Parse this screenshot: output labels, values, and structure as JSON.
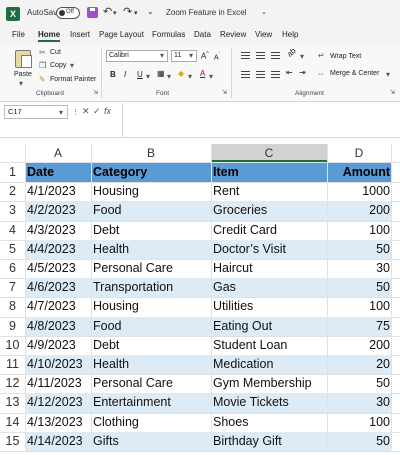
{
  "titlebar": {
    "app_logo": "X",
    "autosave_label": "AutoSave",
    "toggle_state": "Off",
    "document_title": "Zoom Feature in Excel"
  },
  "menu": {
    "tabs": [
      "File",
      "Home",
      "Insert",
      "Page Layout",
      "Formulas",
      "Data",
      "Review",
      "View",
      "Help"
    ],
    "active": "Home"
  },
  "ribbon": {
    "clipboard": {
      "paste": "Paste",
      "cut": "Cut",
      "copy": "Copy",
      "format_painter": "Format Painter",
      "group_label": "Clipboard"
    },
    "font": {
      "font_name": "Calibri",
      "font_size": "11",
      "bold": "B",
      "italic": "I",
      "underline": "U",
      "font_color_glyph": "A",
      "group_label": "Font"
    },
    "alignment": {
      "wrap_text": "Wrap Text",
      "merge_center": "Merge & Center",
      "group_label": "Alignment"
    }
  },
  "formula_bar": {
    "name_box": "C17",
    "fx": "fx",
    "value": ""
  },
  "sheet": {
    "columns": [
      "A",
      "B",
      "C",
      "D"
    ],
    "selected_column": "C",
    "row_numbers": [
      "1",
      "2",
      "3",
      "4",
      "5",
      "6",
      "7",
      "8",
      "9",
      "10",
      "11",
      "12",
      "13",
      "14",
      "15"
    ],
    "header": {
      "date": "Date",
      "category": "Category",
      "item": "Item",
      "amount": "Amount"
    },
    "rows": [
      {
        "date": "4/1/2023",
        "category": "Housing",
        "item": "Rent",
        "amount": "1000"
      },
      {
        "date": "4/2/2023",
        "category": "Food",
        "item": "Groceries",
        "amount": "200"
      },
      {
        "date": "4/3/2023",
        "category": "Debt",
        "item": "Credit Card",
        "amount": "100"
      },
      {
        "date": "4/4/2023",
        "category": "Health",
        "item": "Doctor’s Visit",
        "amount": "50"
      },
      {
        "date": "4/5/2023",
        "category": "Personal Care",
        "item": "Haircut",
        "amount": "30"
      },
      {
        "date": "4/6/2023",
        "category": "Transportation",
        "item": "Gas",
        "amount": "50"
      },
      {
        "date": "4/7/2023",
        "category": "Housing",
        "item": "Utilities",
        "amount": "100"
      },
      {
        "date": "4/8/2023",
        "category": "Food",
        "item": "Eating Out",
        "amount": "75"
      },
      {
        "date": "4/9/2023",
        "category": "Debt",
        "item": "Student Loan",
        "amount": "200"
      },
      {
        "date": "4/10/2023",
        "category": "Health",
        "item": "Medication",
        "amount": "20"
      },
      {
        "date": "4/11/2023",
        "category": "Personal Care",
        "item": "Gym Membership",
        "amount": "50"
      },
      {
        "date": "4/12/2023",
        "category": "Entertainment",
        "item": "Movie Tickets",
        "amount": "30"
      },
      {
        "date": "4/13/2023",
        "category": "Clothing",
        "item": "Shoes",
        "amount": "100"
      },
      {
        "date": "4/14/2023",
        "category": "Gifts",
        "item": "Birthday Gift",
        "amount": "50"
      }
    ]
  },
  "colors": {
    "excel_green": "#1d6f42",
    "table_header": "#5b9bd5",
    "table_band": "#ddebf7"
  }
}
